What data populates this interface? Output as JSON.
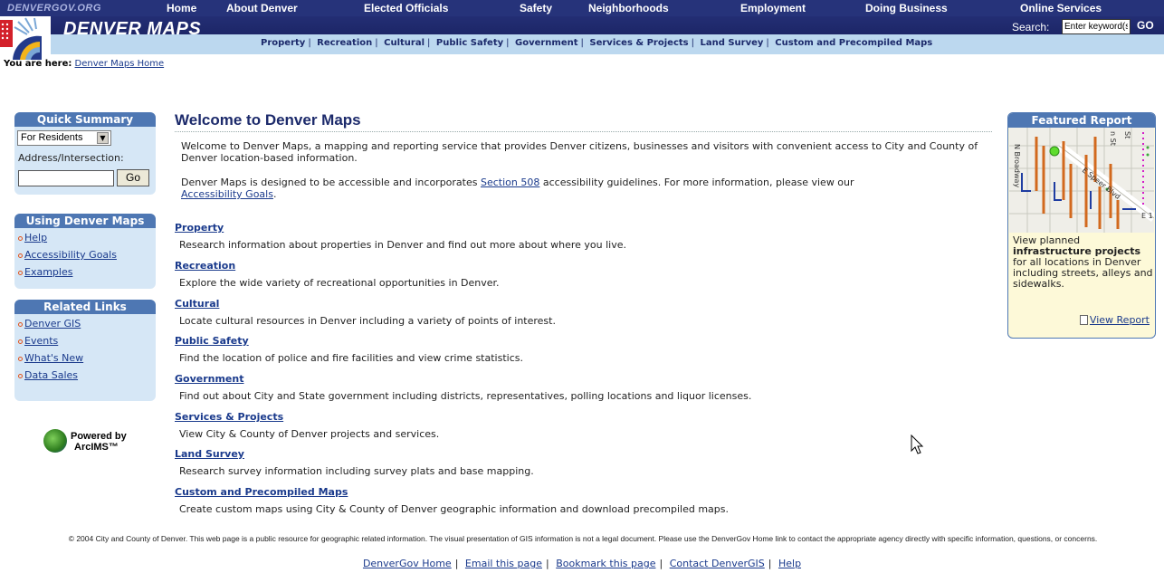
{
  "topnav": {
    "site": "DENVERGOV.ORG",
    "items": [
      "Home",
      "About Denver",
      "Elected Officials",
      "Safety",
      "Neighborhoods",
      "Employment",
      "Doing Business",
      "Online Services"
    ]
  },
  "banner": {
    "title": "DENVER MAPS",
    "search_label": "Search:",
    "search_placeholder": "Enter keyword(s)",
    "go_label": "GO"
  },
  "subnav": [
    "Property",
    "Recreation",
    "Cultural",
    "Public Safety",
    "Government",
    "Services & Projects",
    "Land Survey",
    "Custom and Precompiled Maps"
  ],
  "breadcrumb": {
    "label": "You are here:",
    "link": "Denver Maps Home"
  },
  "quick_summary": {
    "title": "Quick Summary",
    "select_value": "For Residents",
    "address_label": "Address/Intersection:",
    "go_label": "Go"
  },
  "using": {
    "title": "Using Denver Maps",
    "items": [
      "Help",
      "Accessibility Goals",
      "Examples"
    ]
  },
  "related": {
    "title": "Related Links",
    "items": [
      "Denver GIS",
      "Events",
      "What's New",
      "Data Sales"
    ]
  },
  "arcims": {
    "line1": "Powered by",
    "line2": "ArcIMS™"
  },
  "main": {
    "title": "Welcome to Denver Maps",
    "intro1": "Welcome to Denver Maps, a mapping and reporting service that provides Denver citizens, businesses and visitors with convenient access to City and County of Denver location-based information.",
    "intro2_pre": "Denver Maps is designed to be accessible and incorporates ",
    "intro2_link1": "Section 508",
    "intro2_mid": " accessibility guidelines. For more information, please view our",
    "intro2_link2": "Accessibility Goals",
    "intro2_post": ".",
    "sections": [
      {
        "title": "Property",
        "desc": "Research information about properties in Denver and find out more about where you live."
      },
      {
        "title": "Recreation",
        "desc": "Explore the wide variety of recreational opportunities in Denver."
      },
      {
        "title": "Cultural",
        "desc": "Locate cultural resources in Denver including a variety of points of interest."
      },
      {
        "title": "Public Safety",
        "desc": "Find the location of police and fire facilities and view crime statistics."
      },
      {
        "title": "Government",
        "desc": "Find out about City and State government including districts, representatives, polling locations and liquor licenses."
      },
      {
        "title": "Services & Projects",
        "desc": "View City & County of Denver projects and services."
      },
      {
        "title": "Land Survey",
        "desc": "Research survey information including survey plats and base mapping."
      },
      {
        "title": "Custom and Precompiled Maps",
        "desc": "Create custom maps using City & County of Denver geographic information and download precompiled maps."
      }
    ]
  },
  "featured": {
    "title": "Featured Report",
    "map_labels": [
      "N Broadway",
      "E Speer Blvd",
      "E 1",
      "n St",
      "St"
    ],
    "text_pre": "View planned ",
    "text_bold": "infrastructure projects",
    "text_post": " for all locations in Denver including streets, alleys and sidewalks.",
    "link": "View Report"
  },
  "footer": {
    "text": "© 2004 City and County of Denver. This web page is a public resource for geographic related information. The visual presentation of GIS information is not a legal document. Please use the DenverGov Home link to contact the appropriate agency directly with specific information, questions, or concerns.",
    "links": [
      "DenverGov Home",
      "Email this page",
      "Bookmark this page",
      "Contact DenverGIS",
      "Help"
    ]
  },
  "colors": {
    "nav_bg": "#26337a",
    "subnav_bg": "#bcd8ef",
    "sidebox_bg": "#d6e7f6",
    "sidebox_hdr": "#4e77b3",
    "link": "#1a3a8c",
    "featured_bg": "#fdf9d8"
  }
}
